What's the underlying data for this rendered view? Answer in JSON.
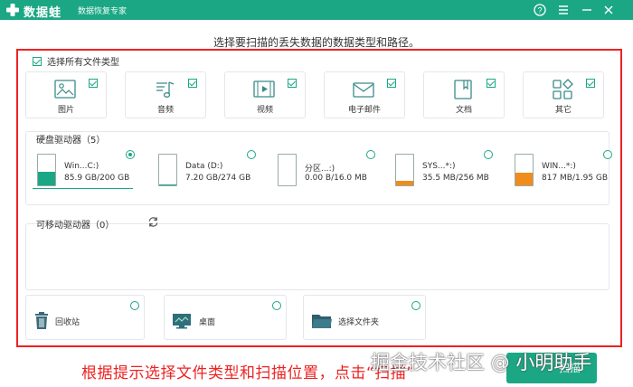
{
  "window": {
    "app_name": "数据蛙",
    "app_subtitle": "数据恢复专家",
    "controls": [
      "?",
      "☰",
      "—",
      "✕"
    ]
  },
  "heading": "选择要扫描的丢失数据的数据类型和路径。",
  "select_all": {
    "label": "选择所有文件类型",
    "checked": true
  },
  "file_types": [
    {
      "label": "图片",
      "icon": "image-icon",
      "checked": true
    },
    {
      "label": "音频",
      "icon": "music-icon",
      "checked": true
    },
    {
      "label": "视频",
      "icon": "video-icon",
      "checked": true
    },
    {
      "label": "电子邮件",
      "icon": "mail-icon",
      "checked": true
    },
    {
      "label": "文档",
      "icon": "document-icon",
      "checked": true
    },
    {
      "label": "其它",
      "icon": "other-icon",
      "checked": true
    }
  ],
  "hard_drives": {
    "title": "硬盘驱动器（5）",
    "drives": [
      {
        "name": "Win...C:)",
        "size": "85.9 GB/200 GB",
        "fill": 0.43,
        "fill_color": "#1ba784",
        "selected": true
      },
      {
        "name": "Data (D:)",
        "size": "7.20 GB/274 GB",
        "fill": 0.03,
        "fill_color": "#1ba784",
        "selected": false
      },
      {
        "name": "分区...:)",
        "size": "0.00  B/16.0 MB",
        "fill": 0.0,
        "fill_color": "#f08c1c",
        "selected": false
      },
      {
        "name": "SYS...*:)",
        "size": "35.5 MB/256 MB",
        "fill": 0.14,
        "fill_color": "#f08c1c",
        "selected": false
      },
      {
        "name": "WIN...*:)",
        "size": "817 MB/1.95 GB",
        "fill": 0.42,
        "fill_color": "#f08c1c",
        "selected": false
      }
    ]
  },
  "removable": {
    "title": "可移动驱动器（0）"
  },
  "locations": [
    {
      "label": "回收站",
      "icon": "recycle-bin-icon"
    },
    {
      "label": "桌面",
      "icon": "desktop-icon"
    },
    {
      "label": "选择文件夹",
      "icon": "folder-icon"
    }
  ],
  "instruction": "根据提示选择文件类型和扫描位置，点击“扫描”",
  "scan_button": "扫描",
  "watermark": "掘金技术社区 @ 小明助手",
  "colors": {
    "accent": "#1ba784",
    "warning": "#f08c1c",
    "annotation": "#e22222"
  }
}
